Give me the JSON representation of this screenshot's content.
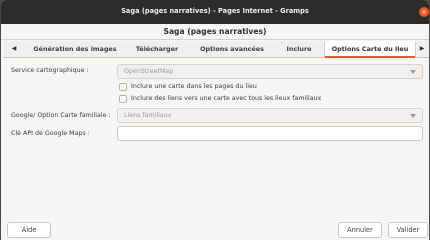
{
  "window": {
    "title": "Saga (pages narratives) - Pages Internet - Gramps",
    "close_glyph": "×"
  },
  "header": {
    "title": "Saga (pages narratives)"
  },
  "tabs": {
    "scroll_left": "◀",
    "scroll_right": "▶",
    "items": [
      {
        "label": "Génération des images"
      },
      {
        "label": "Télécharger"
      },
      {
        "label": "Options avancées"
      },
      {
        "label": "Inclure"
      },
      {
        "label": "Options Carte du lieu",
        "active": true
      }
    ]
  },
  "form": {
    "map_service_label": "Service cartographique :",
    "map_service_value": "OpenStreetMap",
    "include_map_label": "Inclure une carte dans les pages du lieu",
    "include_map_checked": false,
    "include_links_label": "Inclure des liens vers une carte avec tous les lieux familiaux",
    "include_links_checked": false,
    "google_option_label": "Google/ Option Carte familiale :",
    "google_option_value": "Liens familiaux",
    "api_key_label": "Clé API de Google Maps :",
    "api_key_value": ""
  },
  "buttons": {
    "help": "Aide",
    "cancel": "Annuler",
    "ok": "Valider"
  },
  "colors": {
    "accent": "#e95420",
    "titlebar": "#2c2c2c",
    "window_bg": "#f6f5f4"
  }
}
